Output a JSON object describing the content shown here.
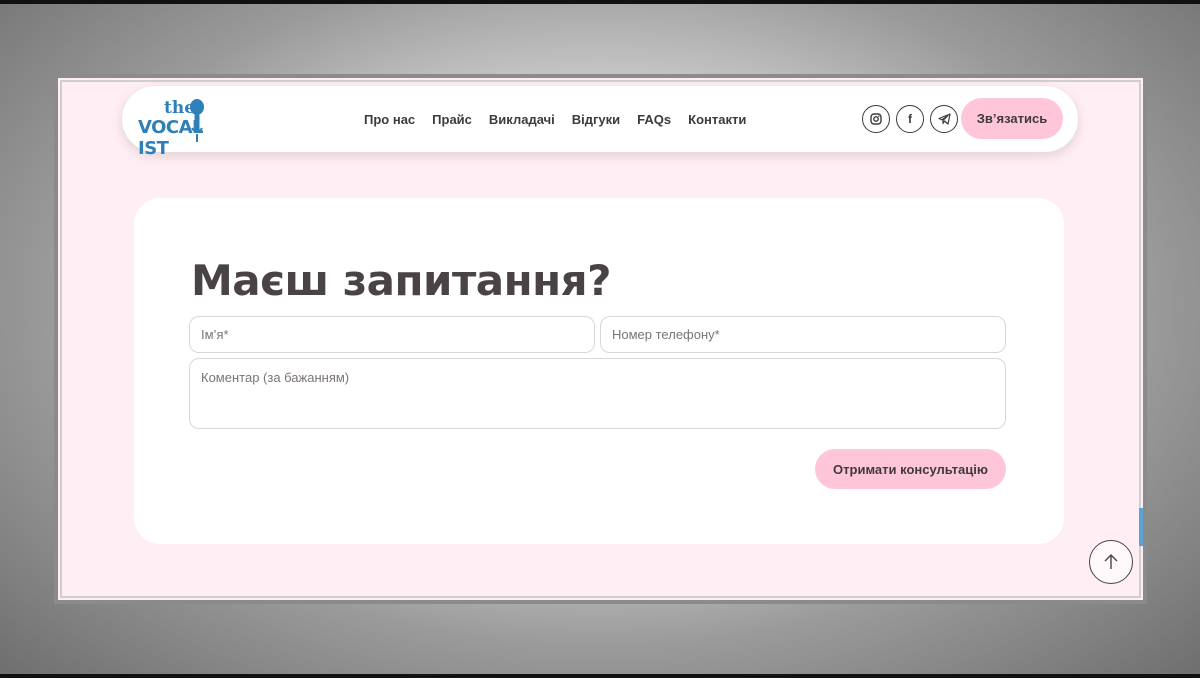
{
  "logo": {
    "line1": "the",
    "line2": "VOCAL IST"
  },
  "nav": {
    "items": [
      {
        "label": "Про нас"
      },
      {
        "label": "Прайс"
      },
      {
        "label": "Викладачі"
      },
      {
        "label": "Відгуки"
      },
      {
        "label": "FAQs"
      },
      {
        "label": "Контакти"
      }
    ]
  },
  "social": {
    "items": [
      {
        "icon": "instagram-icon"
      },
      {
        "icon": "facebook-icon",
        "glyph": "f"
      },
      {
        "icon": "telegram-icon"
      }
    ]
  },
  "header": {
    "contact_label": "Зв’язатись"
  },
  "form": {
    "title": "Маєш запитання?",
    "name_placeholder": "Ім’я*",
    "phone_placeholder": "Номер телефону*",
    "comment_placeholder": "Коментар (за бажанням)",
    "submit_label": "Отримати консультацію"
  },
  "colors": {
    "page_bg": "#ffeef3",
    "accent_pink": "#ffc6d9",
    "brand_blue": "#2f7fb8",
    "text_dark": "#4a4345"
  },
  "scroll_top": {
    "icon": "arrow-up-icon"
  }
}
